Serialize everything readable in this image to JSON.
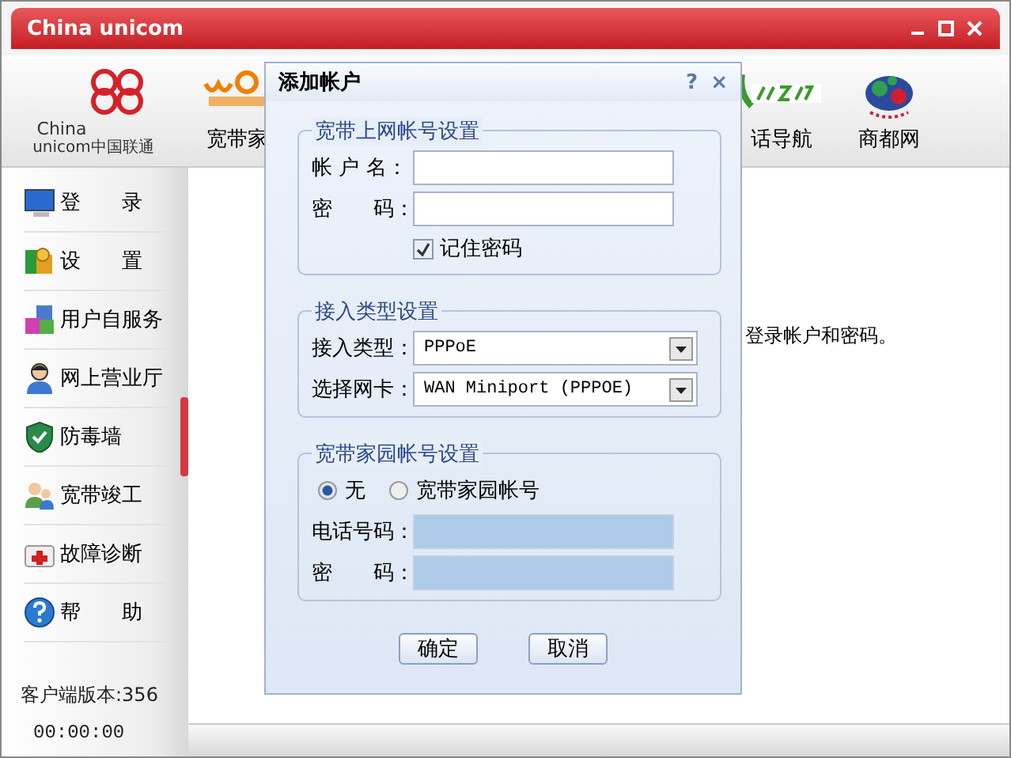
{
  "window": {
    "title": "China unicom"
  },
  "logo": {
    "line1": "China",
    "line2": "unicom中国联通"
  },
  "toolbar": [
    "宽带家",
    "话导航",
    "商都网"
  ],
  "sidebar": {
    "items": [
      {
        "label": "登　　录"
      },
      {
        "label": "设　　置"
      },
      {
        "label": "用户自服务"
      },
      {
        "label": "网上营业厅"
      },
      {
        "label": "防毒墙"
      },
      {
        "label": "宽带竣工"
      },
      {
        "label": "故障诊断"
      },
      {
        "label": "帮　　助"
      }
    ],
    "version": "客户端版本:356",
    "timer": "00:00:00"
  },
  "content": {
    "message": "登录帐户和密码。"
  },
  "dialog": {
    "title": "添加帐户",
    "help": "?",
    "close": "×",
    "account_group": {
      "legend": "宽带上网帐号设置",
      "username_label": "帐 户 名：",
      "password_label": "密　　码：",
      "remember": {
        "label": "记住密码",
        "checked": true
      }
    },
    "access_group": {
      "legend": "接入类型设置",
      "type_label": "接入类型：",
      "type_value": "PPPoE",
      "adapter_label": "选择网卡：",
      "adapter_value": "WAN Miniport (PPPOE)"
    },
    "home_group": {
      "legend": "宽带家园帐号设置",
      "options": [
        {
          "label": "无",
          "selected": true
        },
        {
          "label": "宽带家园帐号",
          "selected": false
        }
      ],
      "phone_label": "电话号码：",
      "phone_disabled": true,
      "password_label": "密　　码：",
      "password_disabled": true
    },
    "buttons": [
      "确定",
      "取消"
    ]
  }
}
